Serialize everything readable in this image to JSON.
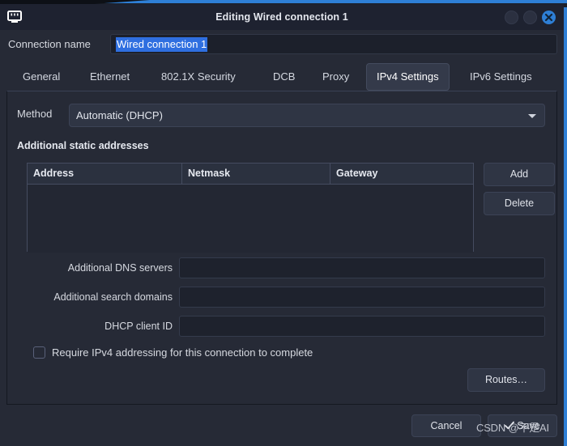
{
  "window": {
    "title": "Editing Wired connection 1",
    "icon": "ethernet-port-icon",
    "accent_color": "#2e7fd6",
    "controls": {
      "minimize": "",
      "maximize": "",
      "close": "✕"
    }
  },
  "connection": {
    "label": "Connection name",
    "value": "Wired connection 1",
    "selected": true
  },
  "tabs": [
    {
      "label": "General",
      "active": false
    },
    {
      "label": "Ethernet",
      "active": false
    },
    {
      "label": "802.1X Security",
      "active": false
    },
    {
      "label": "DCB",
      "active": false
    },
    {
      "label": "Proxy",
      "active": false
    },
    {
      "label": "IPv4 Settings",
      "active": true
    },
    {
      "label": "IPv6 Settings",
      "active": false
    }
  ],
  "method": {
    "label": "Method",
    "value": "Automatic (DHCP)",
    "icon": "chevron-down-icon"
  },
  "static_addresses": {
    "title": "Additional static addresses",
    "columns": [
      "Address",
      "Netmask",
      "Gateway"
    ],
    "rows": [],
    "add_label": "Add",
    "delete_label": "Delete"
  },
  "fields": [
    {
      "label": "Additional DNS servers",
      "value": "",
      "placeholder": ""
    },
    {
      "label": "Additional search domains",
      "value": "",
      "placeholder": ""
    },
    {
      "label": "DHCP client ID",
      "value": "",
      "placeholder": ""
    }
  ],
  "require_ipv4": {
    "label": "Require IPv4 addressing for this connection to complete",
    "checked": false
  },
  "routes": {
    "label": "Routes…"
  },
  "footer": {
    "cancel_label": "Cancel",
    "save_label": "Save",
    "save_icon": "check-icon"
  },
  "watermark": {
    "text": "CSDN @不是AI"
  }
}
